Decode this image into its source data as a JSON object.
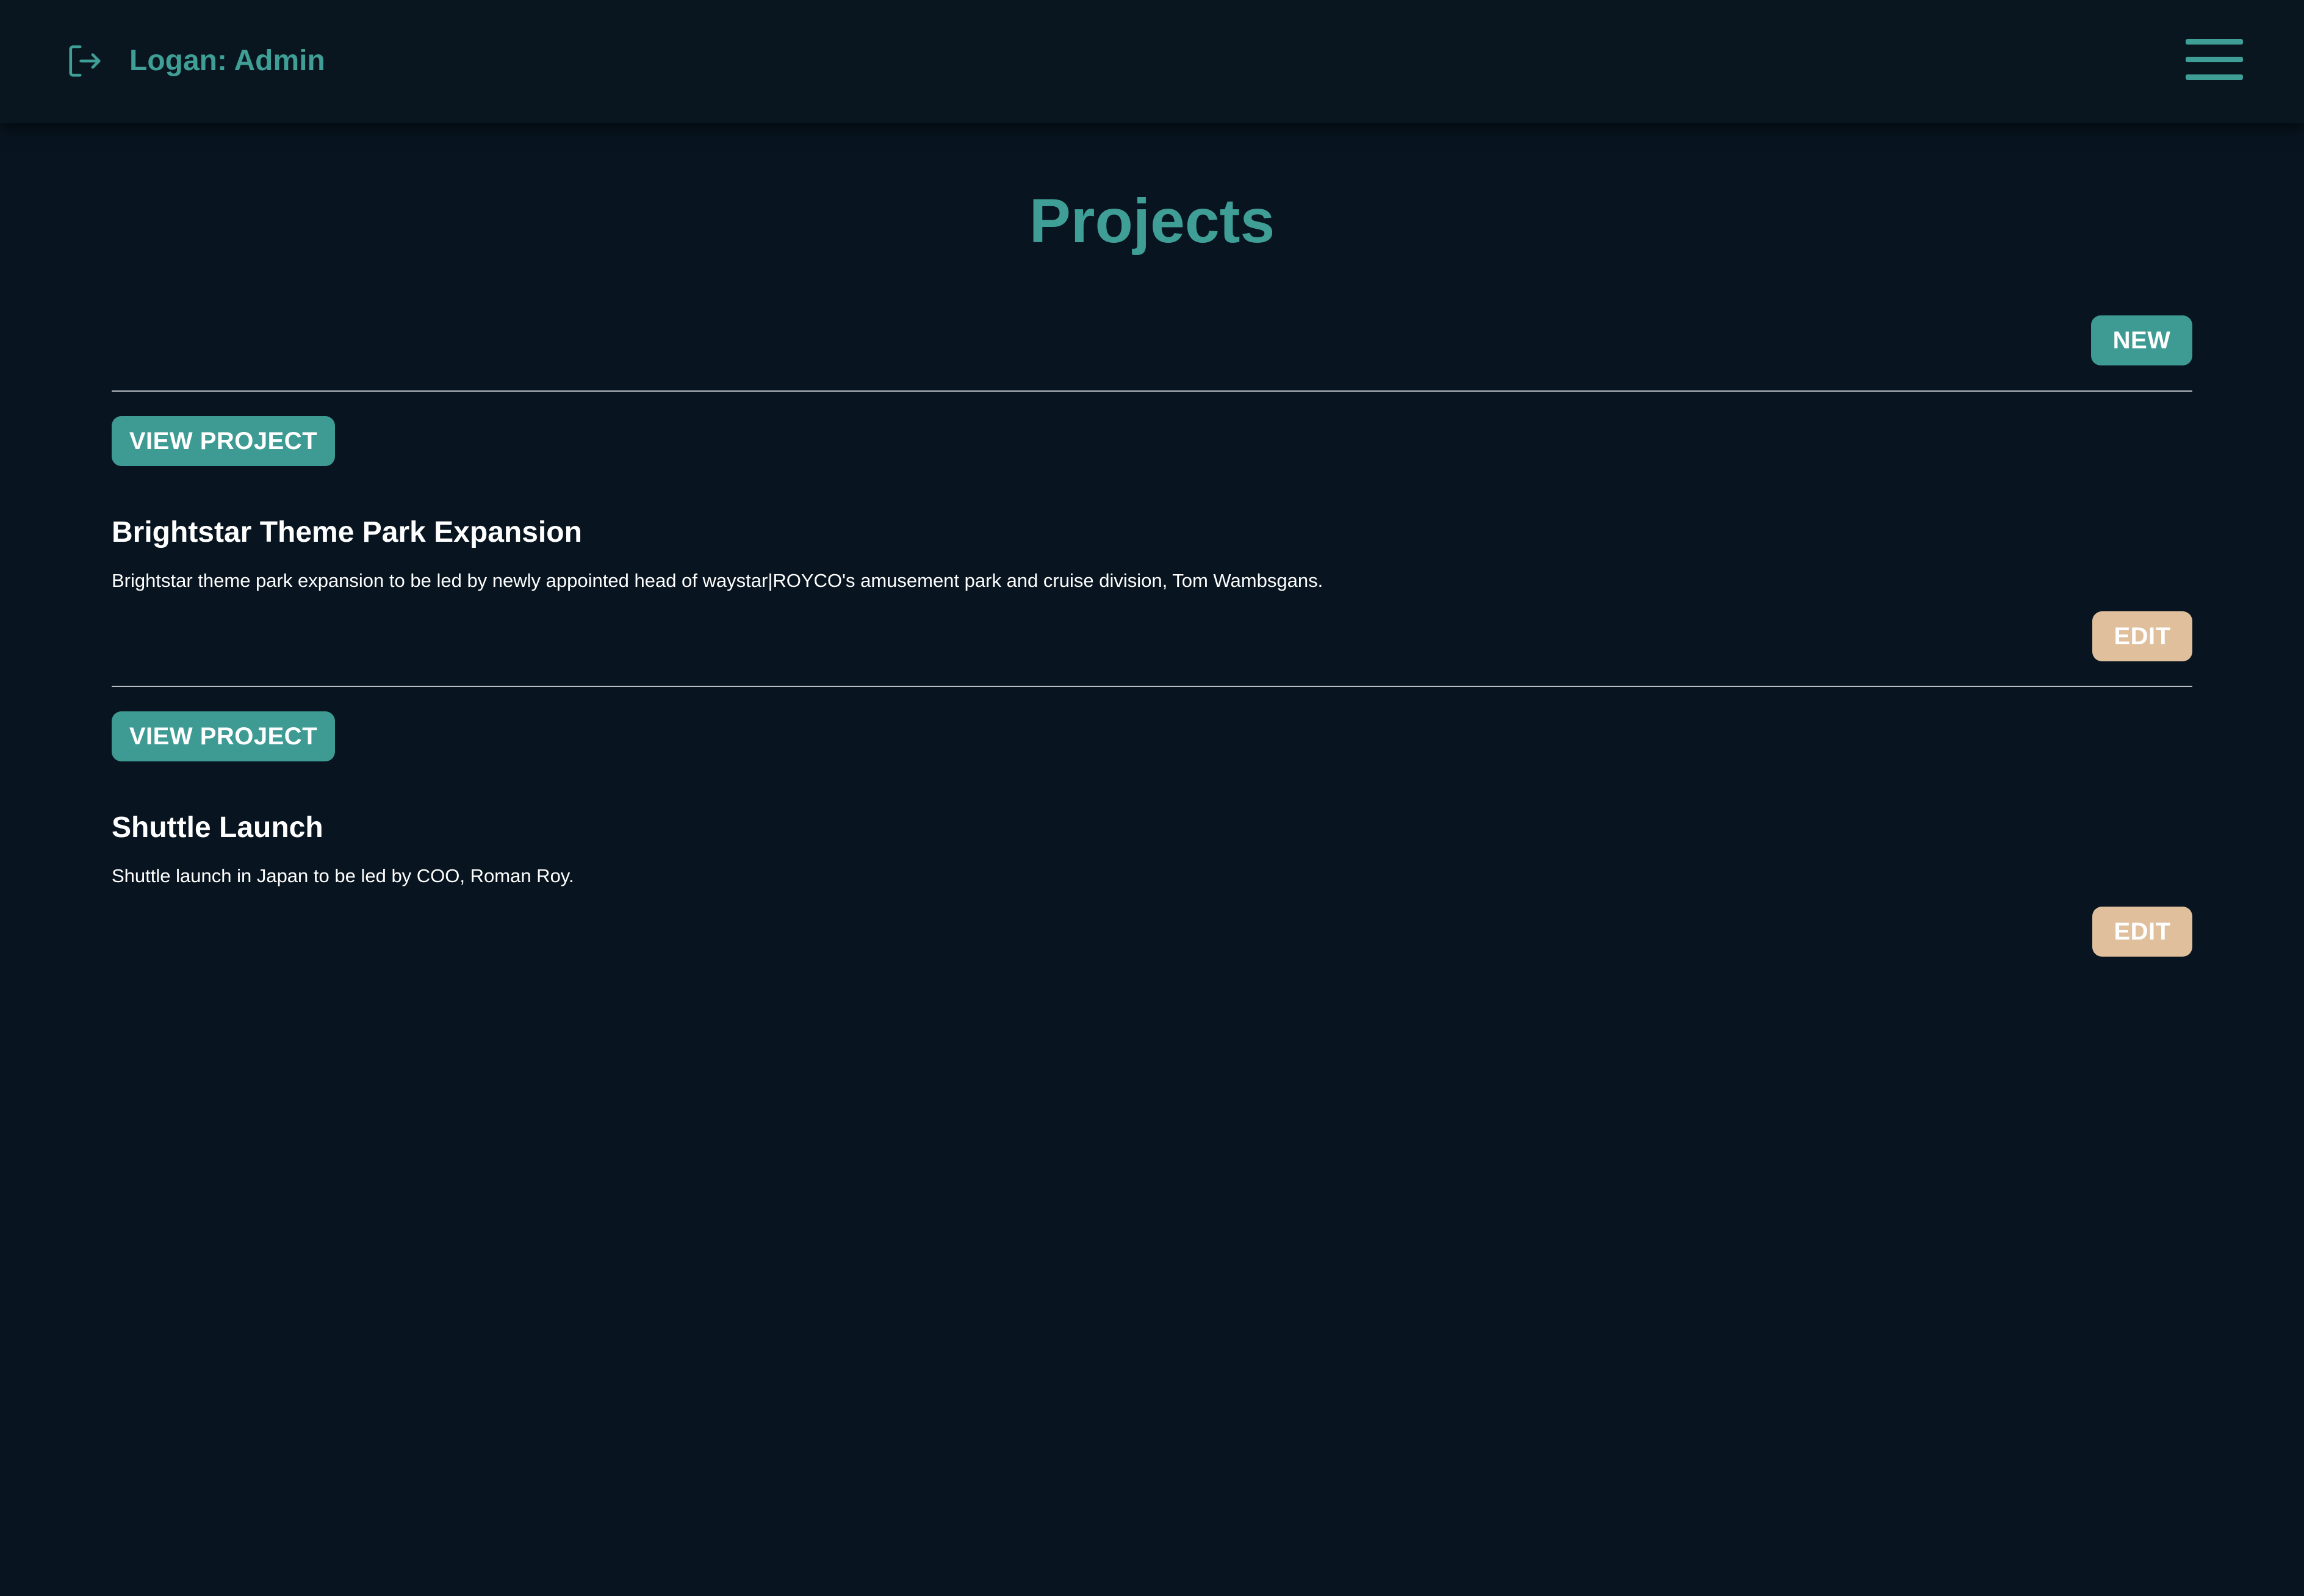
{
  "header": {
    "user_label": "Logan: Admin",
    "logout_icon": "logout-icon",
    "menu_icon": "hamburger-menu-icon"
  },
  "page": {
    "title": "Projects",
    "new_button_label": "NEW"
  },
  "projects": [
    {
      "view_button_label": "VIEW PROJECT",
      "title": "Brightstar Theme Park Expansion",
      "description": "Brightstar theme park expansion to be led by newly appointed head of waystar|ROYCO's amusement park and cruise division, Tom Wambsgans.",
      "edit_button_label": "EDIT"
    },
    {
      "view_button_label": "VIEW PROJECT",
      "title": "Shuttle Launch",
      "description": "Shuttle launch in Japan to be led by COO, Roman Roy.",
      "edit_button_label": "EDIT"
    }
  ],
  "colors": {
    "background": "#081520",
    "header_background": "#09161f",
    "accent": "#3e9b94",
    "edit_button": "#dfbf9c",
    "text": "#ffffff",
    "divider": "#b7bec3"
  }
}
